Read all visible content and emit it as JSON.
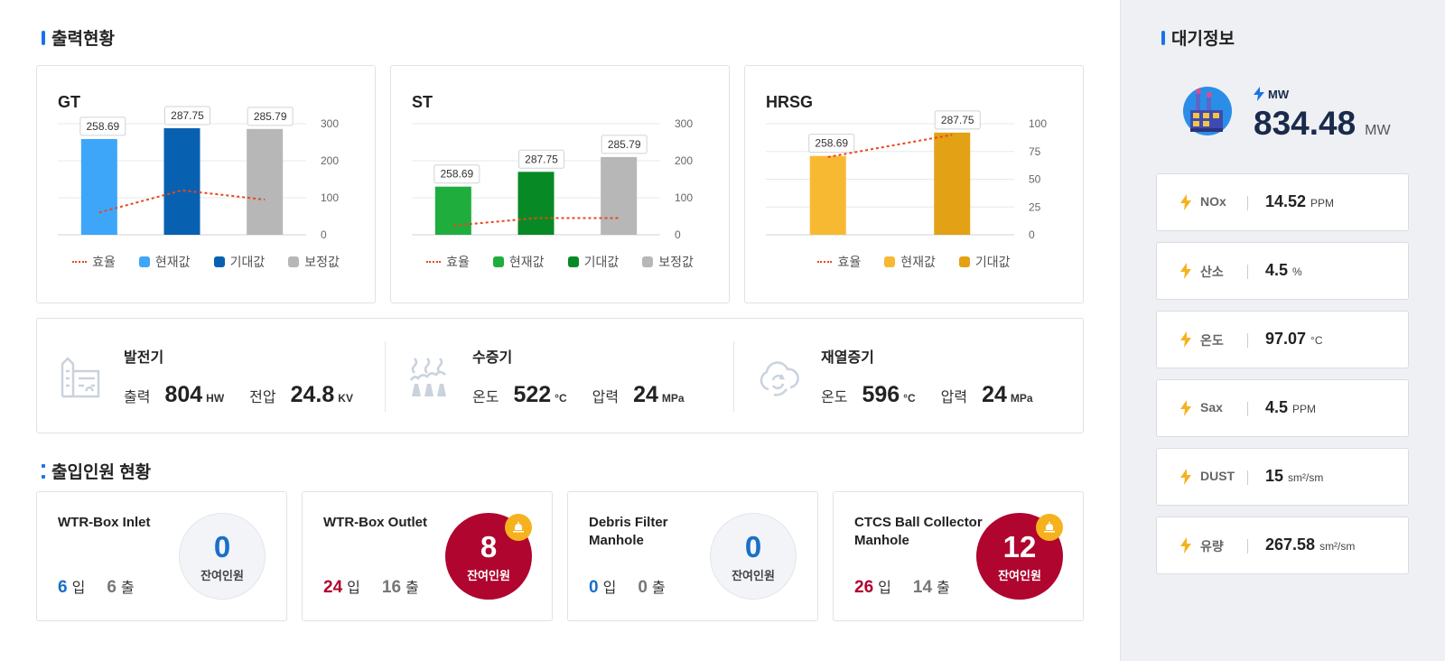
{
  "output_status": {
    "title": "출력현황"
  },
  "access_status": {
    "title": "출입인원 현황"
  },
  "air_info": {
    "title": "대기정보"
  },
  "chart_data": [
    {
      "type": "bar",
      "title": "GT",
      "categories": [
        "현재값",
        "기대값",
        "보정값"
      ],
      "values": [
        258.69,
        287.75,
        285.79
      ],
      "colors": [
        "#3ea6f8",
        "#0861b0",
        "#b7b7b7"
      ],
      "efficiency": [
        60,
        120,
        95
      ],
      "ylim": [
        0,
        300
      ],
      "yticks": [
        0,
        100,
        200,
        300
      ],
      "legend": [
        "효율",
        "현재값",
        "기대값",
        "보정값"
      ]
    },
    {
      "type": "bar",
      "title": "ST",
      "categories": [
        "현재값",
        "기대값",
        "보정값"
      ],
      "values": [
        130,
        170,
        210
      ],
      "labels": [
        "258.69",
        "287.75",
        "285.79"
      ],
      "colors": [
        "#1fae3d",
        "#078a25",
        "#b7b7b7"
      ],
      "efficiency": [
        25,
        45,
        45
      ],
      "ylim": [
        0,
        300
      ],
      "yticks": [
        0,
        100,
        200,
        300
      ],
      "legend": [
        "효율",
        "현재값",
        "기대값",
        "보정값"
      ]
    },
    {
      "type": "bar",
      "title": "HRSG",
      "categories": [
        "현재값",
        "기대값"
      ],
      "values": [
        71,
        92
      ],
      "labels": [
        "258.69",
        "287.75"
      ],
      "colors": [
        "#f8b932",
        "#e3a115"
      ],
      "efficiency": [
        70,
        90
      ],
      "ylim": [
        0,
        100
      ],
      "yticks": [
        0,
        25,
        50,
        75,
        100
      ],
      "legend": [
        "효율",
        "현재값",
        "기대값"
      ]
    }
  ],
  "equipment": [
    {
      "name": "발전기",
      "items": [
        {
          "label": "출력",
          "value": "804",
          "unit": "HW"
        },
        {
          "label": "전압",
          "value": "24.8",
          "unit": "KV"
        }
      ]
    },
    {
      "name": "수증기",
      "items": [
        {
          "label": "온도",
          "value": "522",
          "unit": "°C"
        },
        {
          "label": "압력",
          "value": "24",
          "unit": "MPa"
        }
      ]
    },
    {
      "name": "재열증기",
      "items": [
        {
          "label": "온도",
          "value": "596",
          "unit": "°C"
        },
        {
          "label": "압력",
          "value": "24",
          "unit": "MPa"
        }
      ]
    }
  ],
  "personnel": [
    {
      "name": "WTR-Box Inlet",
      "in": "6",
      "out": "6",
      "in_label": "입",
      "out_label": "출",
      "remaining": "0",
      "remaining_label": "잔여인원"
    },
    {
      "name": "WTR-Box Outlet",
      "in": "24",
      "out": "16",
      "in_label": "입",
      "out_label": "출",
      "remaining": "8",
      "remaining_label": "잔여인원"
    },
    {
      "name": "Debris Filter Manhole",
      "in": "0",
      "out": "0",
      "in_label": "입",
      "out_label": "출",
      "remaining": "0",
      "remaining_label": "잔여인원"
    },
    {
      "name": "CTCS Ball Collector Manhole",
      "in": "26",
      "out": "14",
      "in_label": "입",
      "out_label": "출",
      "remaining": "12",
      "remaining_label": "잔여인원"
    }
  ],
  "mw": {
    "label": "MW",
    "value": "834.48",
    "unit": "MW"
  },
  "air": [
    {
      "label": "NOx",
      "value": "14.52",
      "unit": "PPM"
    },
    {
      "label": "산소",
      "value": "4.5",
      "unit": "%"
    },
    {
      "label": "온도",
      "value": "97.07",
      "unit": "°C"
    },
    {
      "label": "Sax",
      "value": "4.5",
      "unit": "PPM"
    },
    {
      "label": "DUST",
      "value": "15",
      "unit": "sm²/sm"
    },
    {
      "label": "유량",
      "value": "267.58",
      "unit": "sm²/sm"
    }
  ],
  "colors": {
    "accent": "#1a73e8",
    "alert": "#b0052f",
    "in_blue": "#1a6fc8",
    "bell": "#f5b21e",
    "bolt": "#f5b21e"
  }
}
